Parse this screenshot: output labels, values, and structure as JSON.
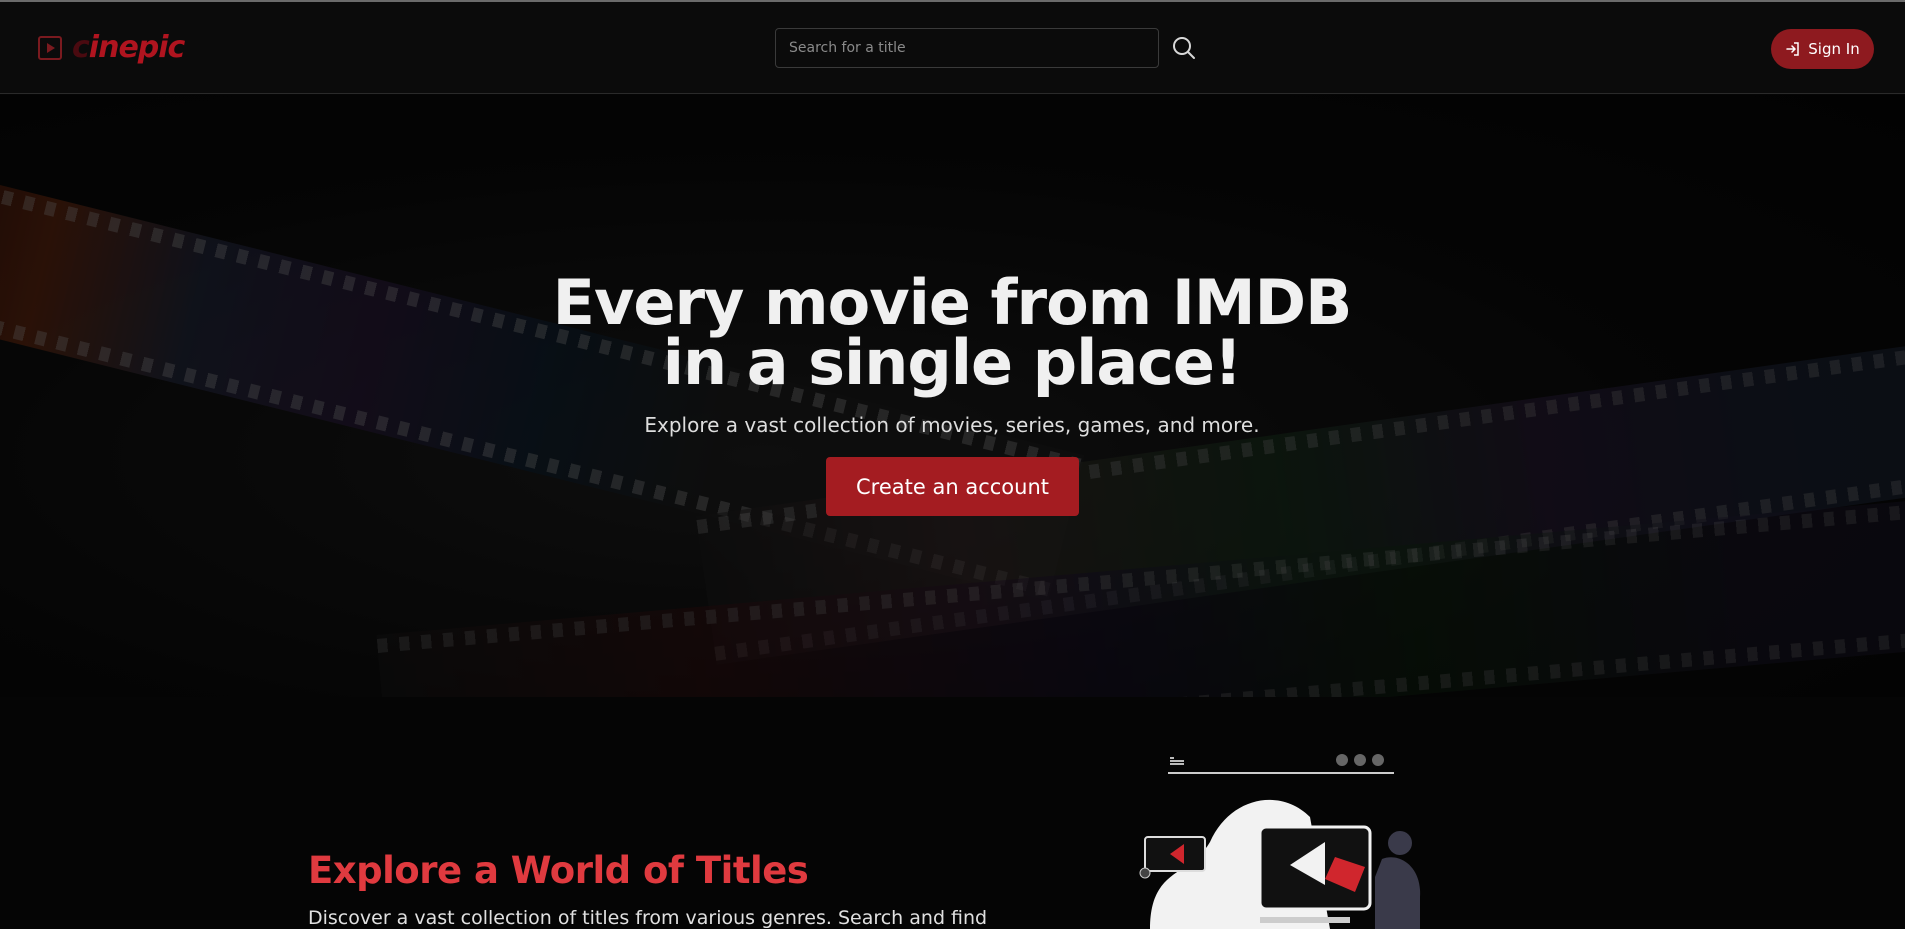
{
  "header": {
    "logo_text_dim": "c",
    "logo_text": "inepic",
    "search_placeholder": "Search for a title",
    "signin_label": "Sign In"
  },
  "hero": {
    "title_line1": "Every movie from IMDB",
    "title_line2": "in a single place!",
    "subtitle": "Explore a vast collection of movies, series, games, and more.",
    "cta_label": "Create an account"
  },
  "section": {
    "title": "Explore a World of Titles",
    "text": "Discover a vast collection of titles from various genres. Search and find"
  },
  "colors": {
    "brand": "#b0141f",
    "accent": "#a41c21",
    "heading_red": "#e03a3f"
  },
  "icons": [
    "play-logo-icon",
    "search-icon",
    "sign-in-icon"
  ]
}
